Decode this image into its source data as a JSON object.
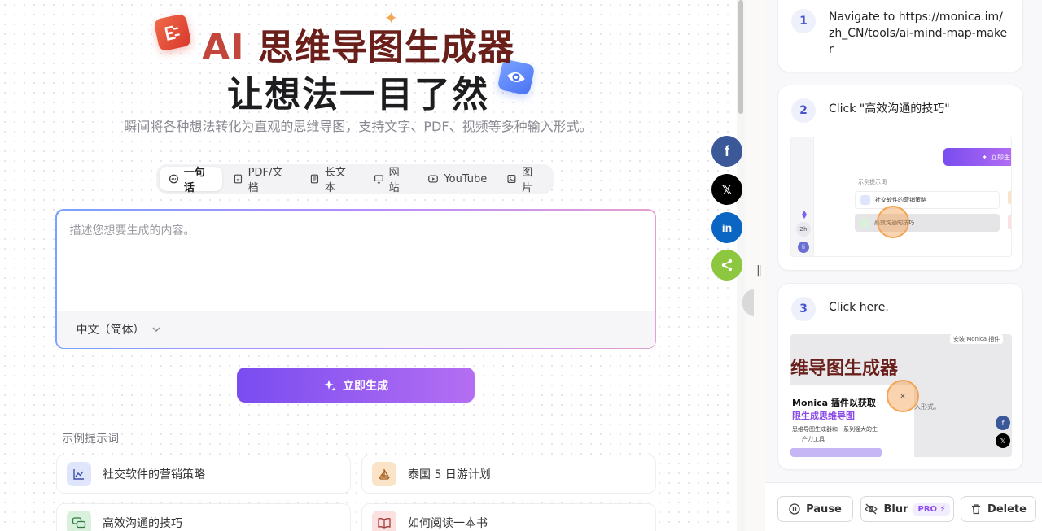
{
  "hero": {
    "title_ai": "AI",
    "title_rest": "思维导图生成器",
    "title_line2": "让想法一目了然",
    "subtitle": "瞬间将各种想法转化为直观的思维导图，支持文字、PDF、视频等多种输入形式。"
  },
  "tabs": [
    {
      "label": "一句话",
      "icon": "chat-bubble-icon",
      "active": true
    },
    {
      "label": "PDF/文档",
      "icon": "document-icon"
    },
    {
      "label": "长文本",
      "icon": "text-file-icon"
    },
    {
      "label": "网站",
      "icon": "monitor-icon"
    },
    {
      "label": "YouTube",
      "icon": "play-icon"
    },
    {
      "label": "图片",
      "icon": "image-icon"
    }
  ],
  "input": {
    "placeholder": "描述您想要生成的内容。",
    "value": ""
  },
  "language": {
    "selected": "中文（简体）"
  },
  "generate_button": "立即生成",
  "examples": {
    "label": "示例提示词",
    "items": [
      {
        "label": "社交软件的营销策略",
        "icon": "chart-line-icon",
        "color": "#dfe6fb"
      },
      {
        "label": "泰国 5 日游计划",
        "icon": "sailboat-icon",
        "color": "#fbe3c8"
      },
      {
        "label": "高效沟通的技巧",
        "icon": "chat-bubbles-icon",
        "color": "#d8f0dc"
      },
      {
        "label": "如何阅读一本书",
        "icon": "open-book-icon",
        "color": "#fbe0e0"
      }
    ]
  },
  "social": [
    {
      "name": "facebook",
      "glyph": "f",
      "color": "#3b5998"
    },
    {
      "name": "x",
      "glyph": "𝕏",
      "color": "#000000"
    },
    {
      "name": "linkedin",
      "glyph": "in",
      "color": "#0a66c2"
    },
    {
      "name": "share",
      "glyph": "",
      "color": "#8dc63f"
    }
  ],
  "steps": [
    {
      "num": "1",
      "text": "Navigate to https://monica.im/zh_CN/tools/ai-mind-map-maker"
    },
    {
      "num": "2",
      "text": "Click \"高效沟通的技巧\"",
      "thumb": {
        "button": "立即生",
        "label": "示例提示词",
        "item1": "社交软件的营销策略",
        "item2": "高效沟通的技巧",
        "zh": "Zh",
        "li": "li"
      }
    },
    {
      "num": "3",
      "text": "Click here.",
      "thumb": {
        "badge": "安装 Monica 插件",
        "title": "维导图生成器",
        "popup_line1": "Monica 插件以获取",
        "popup_line2": "限生成思维导图",
        "popup_line3": "思维导图生成器和一系列强大的生",
        "popup_line4": "产力工具",
        "tail": "入形式。",
        "close": "×",
        "fb": "f",
        "x": "𝕏"
      }
    }
  ],
  "controls": {
    "pause": "Pause",
    "blur": "Blur",
    "pro": "PRO",
    "delete": "Delete"
  }
}
